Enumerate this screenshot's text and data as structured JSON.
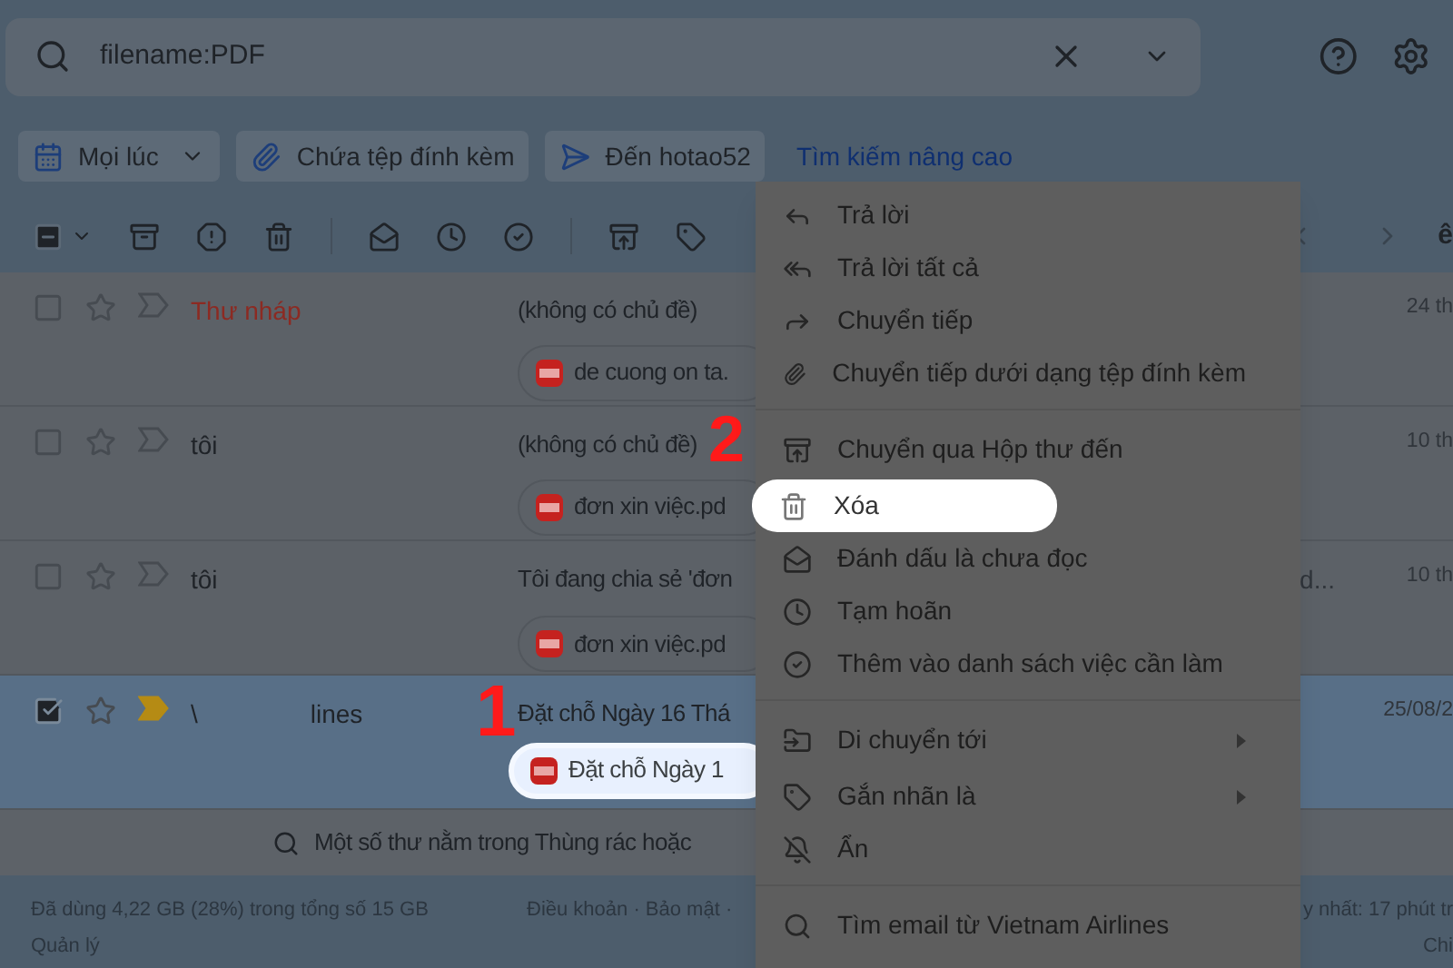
{
  "search": {
    "value": "filename:PDF"
  },
  "chips": [
    {
      "label": "Mọi lúc",
      "dropdown": true
    },
    {
      "label": "Chứa tệp đính kèm",
      "dropdown": false
    },
    {
      "label": "Đến hotao52",
      "dropdown": false
    }
  ],
  "advanced_link": "Tìm kiếm nâng cao",
  "toolbar": {
    "select_all_checked": true,
    "page_text": "ê"
  },
  "rows": [
    {
      "sender": "Thư nháp",
      "sender_extra": "",
      "kind": "draft",
      "subject": "(không có chủ đề)",
      "snippet": "",
      "attachment": "de cuong on ta.",
      "attachment_highlighted": false,
      "date": "24 th",
      "checked": false,
      "important": false
    },
    {
      "sender": "tôi",
      "sender_extra": "",
      "kind": "mail",
      "subject": "(không có chủ đề)",
      "snippet": "",
      "attachment": "đơn xin việc.pd",
      "attachment_highlighted": false,
      "date": "10 th",
      "checked": false,
      "important": false
    },
    {
      "sender": "tôi",
      "sender_extra": "",
      "kind": "mail",
      "subject": "Tôi đang chia sẻ 'đơn",
      "snippet": "d...",
      "attachment": "đơn xin việc.pd",
      "attachment_highlighted": false,
      "date": "10 th",
      "checked": false,
      "important": false
    },
    {
      "sender": "\\",
      "sender_extra": "lines",
      "kind": "mail",
      "subject": "Đặt chỗ Ngày 16 Thá",
      "snippet": "",
      "attachment": "Đặt chỗ Ngày 1",
      "attachment_highlighted": true,
      "date": "25/08/2",
      "checked": true,
      "important": true
    }
  ],
  "notice": "Một số thư nằm trong Thùng rác hoặc",
  "footer": {
    "storage": "Đã dùng 4,22 GB (28%) trong tổng số 15 GB",
    "manage": "Quản lý",
    "links": "Điều khoản · Bảo mật ·",
    "activity": "y nhất: 17 phút tr",
    "details": "Chi"
  },
  "menu": [
    {
      "label": "Trả lời",
      "highlighted": false,
      "submenu": false,
      "divider_before": false
    },
    {
      "label": "Trả lời tất cả",
      "highlighted": false,
      "submenu": false,
      "divider_before": false
    },
    {
      "label": "Chuyển tiếp",
      "highlighted": false,
      "submenu": false,
      "divider_before": false
    },
    {
      "label": "Chuyển tiếp dưới dạng tệp đính kèm",
      "highlighted": false,
      "submenu": false,
      "divider_before": false
    },
    {
      "label": "Chuyển qua Hộp thư đến",
      "highlighted": false,
      "submenu": false,
      "divider_before": true
    },
    {
      "label": "Xóa",
      "highlighted": true,
      "submenu": false,
      "divider_before": false
    },
    {
      "label": "Đánh dấu là chưa đọc",
      "highlighted": false,
      "submenu": false,
      "divider_before": false
    },
    {
      "label": "Tạm hoãn",
      "highlighted": false,
      "submenu": false,
      "divider_before": false
    },
    {
      "label": "Thêm vào danh sách việc cần làm",
      "highlighted": false,
      "submenu": false,
      "divider_before": false
    },
    {
      "label": "Di chuyển tới",
      "highlighted": false,
      "submenu": true,
      "divider_before": true
    },
    {
      "label": "Gắn nhãn là",
      "highlighted": false,
      "submenu": true,
      "divider_before": false
    },
    {
      "label": "Ẩn",
      "highlighted": false,
      "submenu": false,
      "divider_before": false
    },
    {
      "label": "Tìm email từ Vietnam Airlines",
      "highlighted": false,
      "submenu": false,
      "divider_before": true
    }
  ],
  "annotations": [
    {
      "label": "1"
    },
    {
      "label": "2"
    }
  ]
}
